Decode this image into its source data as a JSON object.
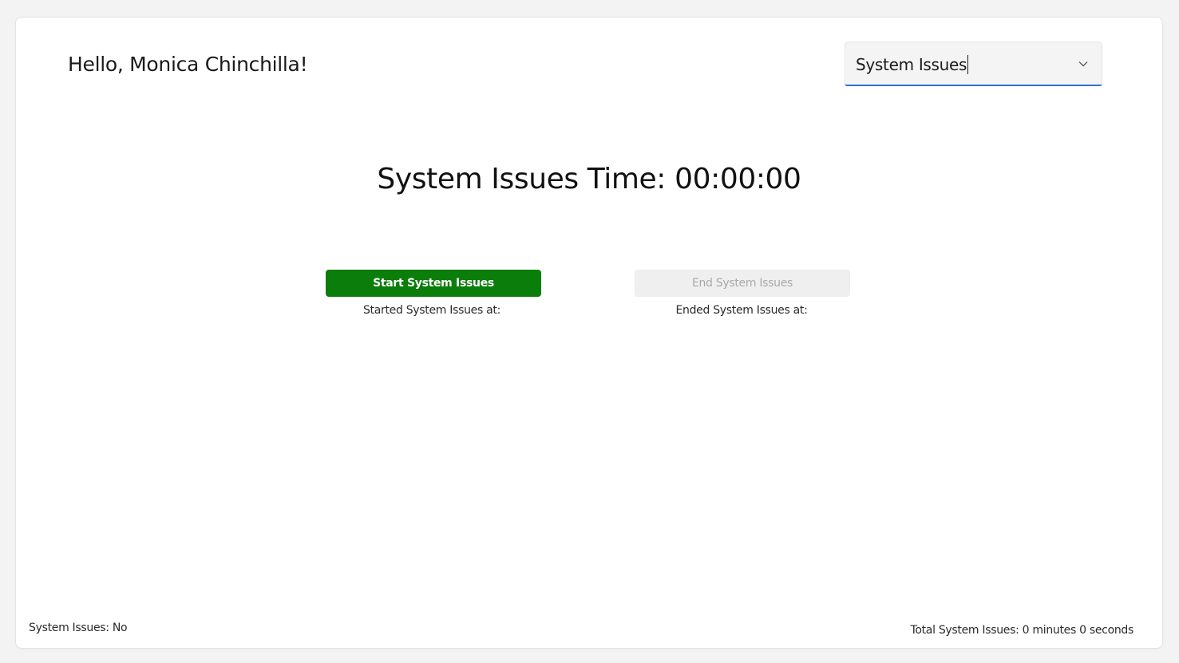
{
  "header": {
    "greeting": "Hello, Monica Chinchilla!"
  },
  "category_select": {
    "value": "System Issues",
    "icon": "chevron-down-icon"
  },
  "timer": {
    "text": "System Issues Time: 00:00:00"
  },
  "actions": {
    "start_label": "Start System Issues",
    "end_label": "End System Issues",
    "started_at_label": "Started System Issues at:",
    "ended_at_label": "Ended System Issues at:"
  },
  "footer": {
    "status_text": "System Issues: No",
    "total_text": "Total System Issues: 0 minutes 0 seconds"
  },
  "colors": {
    "start_button": "#0a7d0a",
    "combo_focus_underline": "#2d6fd6",
    "disabled_text": "#a9a9a9"
  }
}
